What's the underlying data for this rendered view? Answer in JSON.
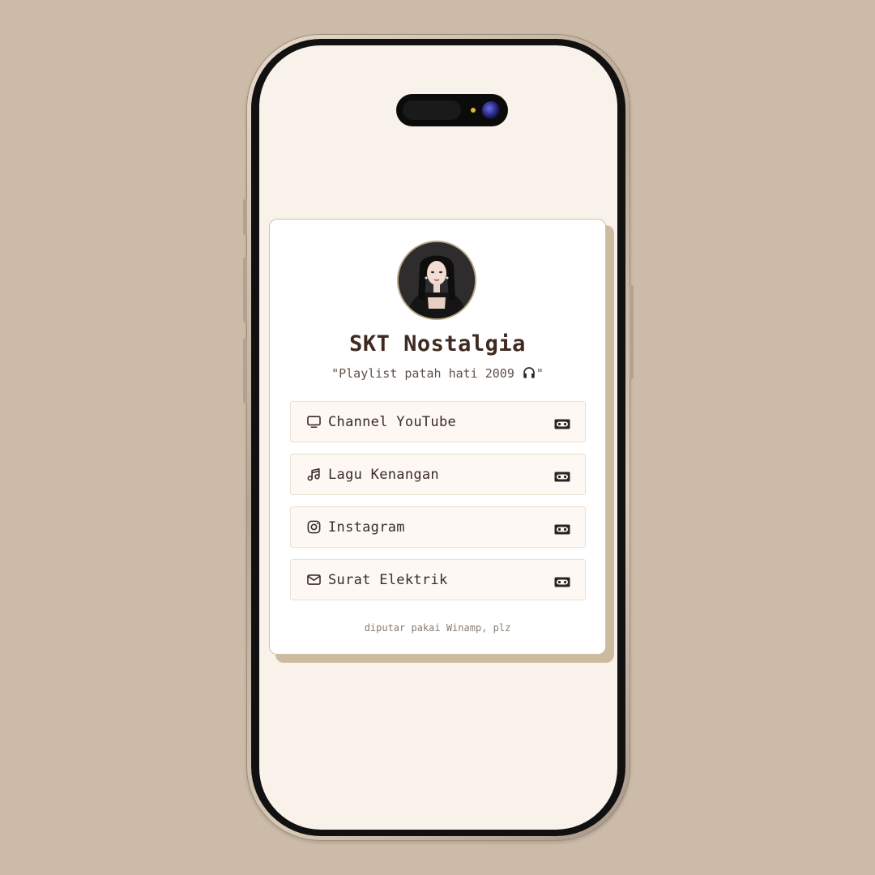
{
  "profile": {
    "name": "SKT Nostalgia",
    "tagline_open": "\"Playlist patah hati 2009 ",
    "tagline_close": "\"",
    "avatar": "profile-photo"
  },
  "links": [
    {
      "label": "Channel YouTube",
      "icon": "tv-icon",
      "badge_icon": "cassette-icon"
    },
    {
      "label": "Lagu Kenangan",
      "icon": "music-note-icon",
      "badge_icon": "cassette-icon"
    },
    {
      "label": "Instagram",
      "icon": "instagram-icon",
      "badge_icon": "cassette-icon"
    },
    {
      "label": "Surat Elektrik",
      "icon": "mail-icon",
      "badge_icon": "cassette-icon"
    }
  ],
  "footer": {
    "text": "diputar pakai Winamp, plz"
  },
  "colors": {
    "background": "#cbbba8",
    "screen": "#f8f2ea",
    "card": "#ffffff",
    "card_shadow": "#cdbb9f",
    "title": "#3e2a20",
    "link_bg": "#fdf8f3"
  }
}
